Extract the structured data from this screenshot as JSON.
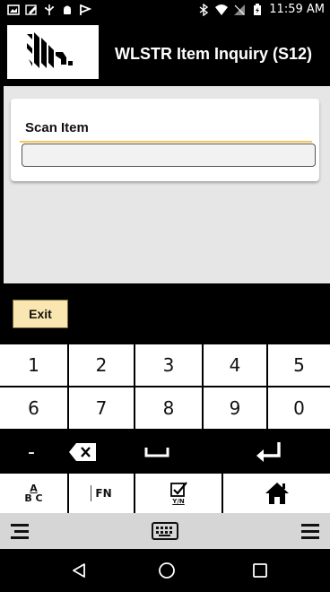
{
  "status_bar": {
    "time": "11:59 AM",
    "left_icons": [
      "image-icon",
      "edit-icon",
      "usb-icon",
      "android-icon",
      "flag-icon"
    ],
    "right_icons": [
      "bluetooth-icon",
      "wifi-icon",
      "signal-icon",
      "battery-icon"
    ]
  },
  "app_bar": {
    "title": "WLSTR Item Inquiry (S12)",
    "logo": "zebra-logo"
  },
  "form": {
    "scan_label": "Scan Item",
    "scan_value": "",
    "scan_placeholder": ""
  },
  "actions": {
    "exit_label": "Exit"
  },
  "keyboard": {
    "row1": [
      "1",
      "2",
      "3",
      "4",
      "5"
    ],
    "row2": [
      "6",
      "7",
      "8",
      "9",
      "0"
    ],
    "minus": "-",
    "fn_label": "FN",
    "abc_top": "A",
    "abc_bottom": "B C",
    "yn_label": "Y/N",
    "icons": [
      "backspace-icon",
      "space-icon",
      "enter-icon",
      "home-icon",
      "menu-icon",
      "keyboard-icon"
    ]
  },
  "colors": {
    "exit_button": "#f9e6b0",
    "focus_line": "#f6c65b"
  }
}
